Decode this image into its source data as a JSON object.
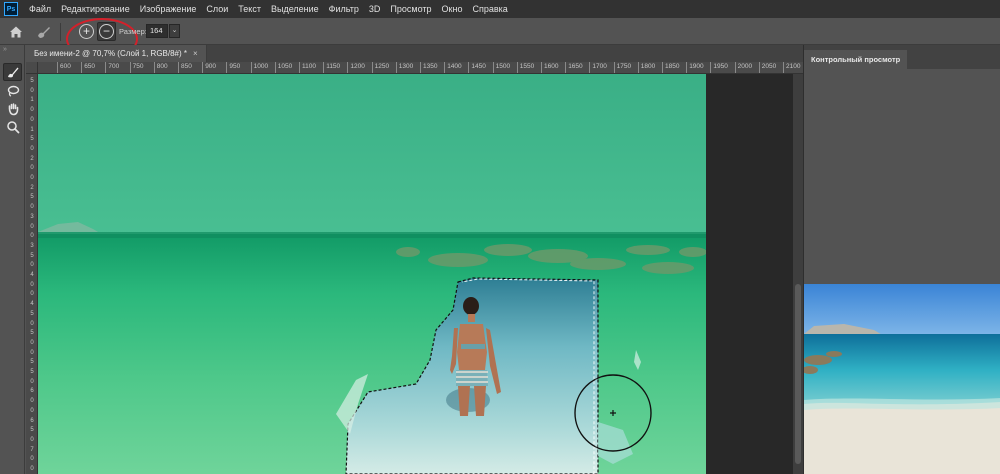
{
  "app": {
    "logo": "Ps",
    "menu": [
      "Файл",
      "Редактирование",
      "Изображение",
      "Слои",
      "Текст",
      "Выделение",
      "Фильтр",
      "3D",
      "Просмотр",
      "Окно",
      "Справка"
    ]
  },
  "options_bar": {
    "home_icon": "home-icon",
    "brush_preset_icon": "brush-preset-icon",
    "add_icon_glyph": "+",
    "subtract_icon_glyph": "−",
    "size_label": "Размер:",
    "size_value": "164",
    "size_dropdown_glyph": "⌄"
  },
  "toolbar": {
    "grip": "»",
    "tools": [
      {
        "name": "refine-brush-tool",
        "glyph": "✎",
        "active": true
      },
      {
        "name": "lasso-tool",
        "glyph": "ↄ",
        "active": false
      },
      {
        "name": "hand-tool",
        "glyph": "✋",
        "active": false
      },
      {
        "name": "zoom-tool",
        "glyph": "🔍",
        "active": false
      }
    ]
  },
  "document": {
    "tab_title": "Без имени-2 @ 70,7% (Слой 1, RGB/8#) *",
    "tab_close": "×"
  },
  "rulers": {
    "horizontal": [
      "600",
      "650",
      "700",
      "750",
      "800",
      "850",
      "900",
      "950",
      "1000",
      "1050",
      "1100",
      "1150",
      "1200",
      "1250",
      "1300",
      "1350",
      "1400",
      "1450",
      "1500",
      "1550",
      "1600",
      "1650",
      "1700",
      "1750",
      "1800",
      "1850",
      "1900",
      "1950",
      "2000",
      "2050",
      "2100",
      "215"
    ],
    "vertical": [
      "5",
      "0",
      "1",
      "0",
      "0",
      "1",
      "5",
      "0",
      "2",
      "0",
      "0",
      "2",
      "5",
      "0",
      "3",
      "0",
      "0",
      "3",
      "5",
      "0",
      "4",
      "0",
      "0",
      "4",
      "5",
      "0",
      "5",
      "0",
      "0",
      "5",
      "5",
      "0",
      "6",
      "0",
      "0",
      "6",
      "5",
      "0",
      "7",
      "0",
      "0"
    ]
  },
  "panel": {
    "tab_label": "Контрольный просмотр"
  },
  "colors": {
    "overlay_green": "#3fbf8a",
    "sky_green": "#40b88c",
    "annotation_red": "#d4202a",
    "ps_blue": "#31a8ff"
  }
}
